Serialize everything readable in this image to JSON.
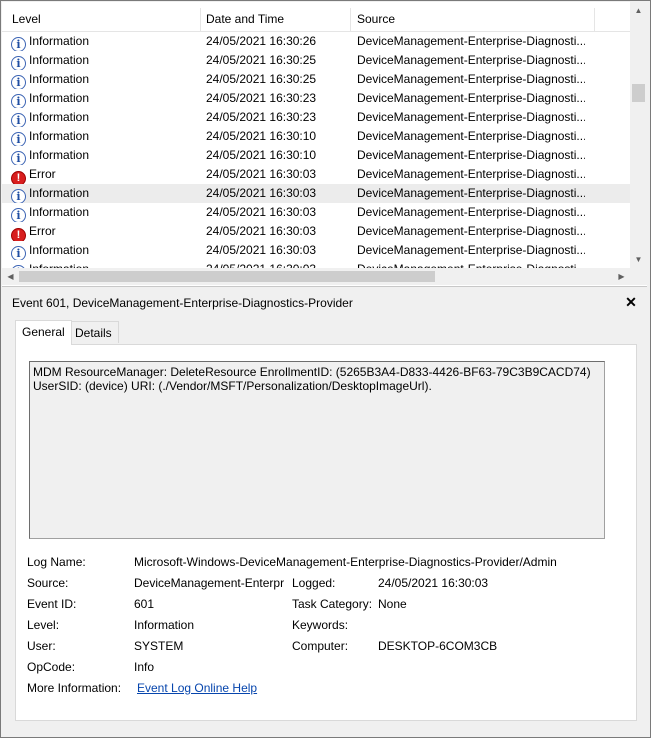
{
  "columns": {
    "level": "Level",
    "date": "Date and Time",
    "source": "Source"
  },
  "events": [
    {
      "level": "Information",
      "icon": "information-icon",
      "date": "24/05/2021 16:30:26",
      "source": "DeviceManagement-Enterprise-Diagnosti..."
    },
    {
      "level": "Information",
      "icon": "information-icon",
      "date": "24/05/2021 16:30:25",
      "source": "DeviceManagement-Enterprise-Diagnosti..."
    },
    {
      "level": "Information",
      "icon": "information-icon",
      "date": "24/05/2021 16:30:25",
      "source": "DeviceManagement-Enterprise-Diagnosti..."
    },
    {
      "level": "Information",
      "icon": "information-icon",
      "date": "24/05/2021 16:30:23",
      "source": "DeviceManagement-Enterprise-Diagnosti..."
    },
    {
      "level": "Information",
      "icon": "information-icon",
      "date": "24/05/2021 16:30:23",
      "source": "DeviceManagement-Enterprise-Diagnosti..."
    },
    {
      "level": "Information",
      "icon": "information-icon",
      "date": "24/05/2021 16:30:10",
      "source": "DeviceManagement-Enterprise-Diagnosti..."
    },
    {
      "level": "Information",
      "icon": "information-icon",
      "date": "24/05/2021 16:30:10",
      "source": "DeviceManagement-Enterprise-Diagnosti..."
    },
    {
      "level": "Error",
      "icon": "error-icon",
      "date": "24/05/2021 16:30:03",
      "source": "DeviceManagement-Enterprise-Diagnosti..."
    },
    {
      "level": "Information",
      "icon": "information-icon",
      "date": "24/05/2021 16:30:03",
      "source": "DeviceManagement-Enterprise-Diagnosti...",
      "selected": true
    },
    {
      "level": "Information",
      "icon": "information-icon",
      "date": "24/05/2021 16:30:03",
      "source": "DeviceManagement-Enterprise-Diagnosti..."
    },
    {
      "level": "Error",
      "icon": "error-icon",
      "date": "24/05/2021 16:30:03",
      "source": "DeviceManagement-Enterprise-Diagnosti..."
    },
    {
      "level": "Information",
      "icon": "information-icon",
      "date": "24/05/2021 16:30:03",
      "source": "DeviceManagement-Enterprise-Diagnosti..."
    },
    {
      "level": "Information",
      "icon": "information-icon",
      "date": "24/05/2021 16:30:03",
      "source": "DeviceManagement-Enterprise-Diagnosti..."
    }
  ],
  "details": {
    "title": "Event 601, DeviceManagement-Enterprise-Diagnostics-Provider",
    "close_glyph": "✕",
    "tabs": {
      "general": "General",
      "details": "Details"
    },
    "description_line1": "MDM ResourceManager: DeleteResource EnrollmentID: (5265B3A4-D833-4426-BF63-79C3B9CACD74)",
    "description_line2": "UserSID: (device) URI: (./Vendor/MSFT/Personalization/DesktopImageUrl).",
    "labels": {
      "log_name": "Log Name:",
      "source": "Source:",
      "event_id": "Event ID:",
      "level": "Level:",
      "user": "User:",
      "opcode": "OpCode:",
      "more_info": "More Information:",
      "logged": "Logged:",
      "task_category": "Task Category:",
      "keywords": "Keywords:",
      "computer": "Computer:"
    },
    "values": {
      "log_name": "Microsoft-Windows-DeviceManagement-Enterprise-Diagnostics-Provider/Admin",
      "source": "DeviceManagement-Enterpr",
      "event_id": "601",
      "level": "Information",
      "user": "SYSTEM",
      "opcode": "Info",
      "more_info_link": "Event Log Online Help",
      "logged": "24/05/2021 16:30:03",
      "task_category": "None",
      "keywords": "",
      "computer": "DESKTOP-6COM3CB"
    }
  }
}
